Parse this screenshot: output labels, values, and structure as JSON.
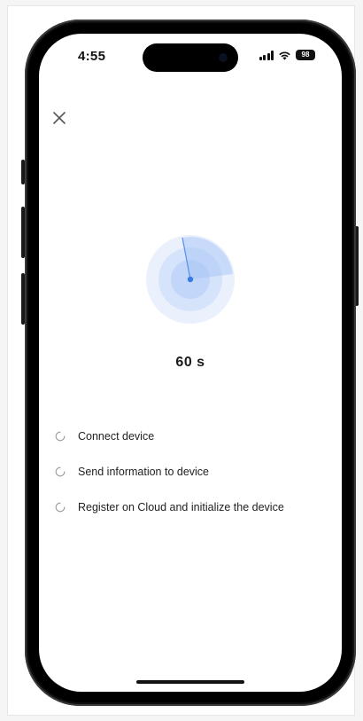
{
  "status_bar": {
    "time": "4:55",
    "battery": "98",
    "signal_icon": "signal-bars-icon",
    "wifi_icon": "wifi-icon"
  },
  "header": {
    "close_icon": "close-icon"
  },
  "progress": {
    "countdown": "60 s",
    "radar_icon": "radar-scan-icon"
  },
  "steps": [
    {
      "label": "Connect device",
      "icon": "loading-spinner-icon"
    },
    {
      "label": "Send information to device",
      "icon": "loading-spinner-icon"
    },
    {
      "label": "Register on Cloud and initialize the device",
      "icon": "loading-spinner-icon"
    }
  ],
  "colors": {
    "accent": "#3a7be0",
    "radar_outer": "#eaf1fd",
    "radar_middle": "#d6e4fb",
    "radar_inner": "#c1d6f8",
    "text": "#222222"
  }
}
